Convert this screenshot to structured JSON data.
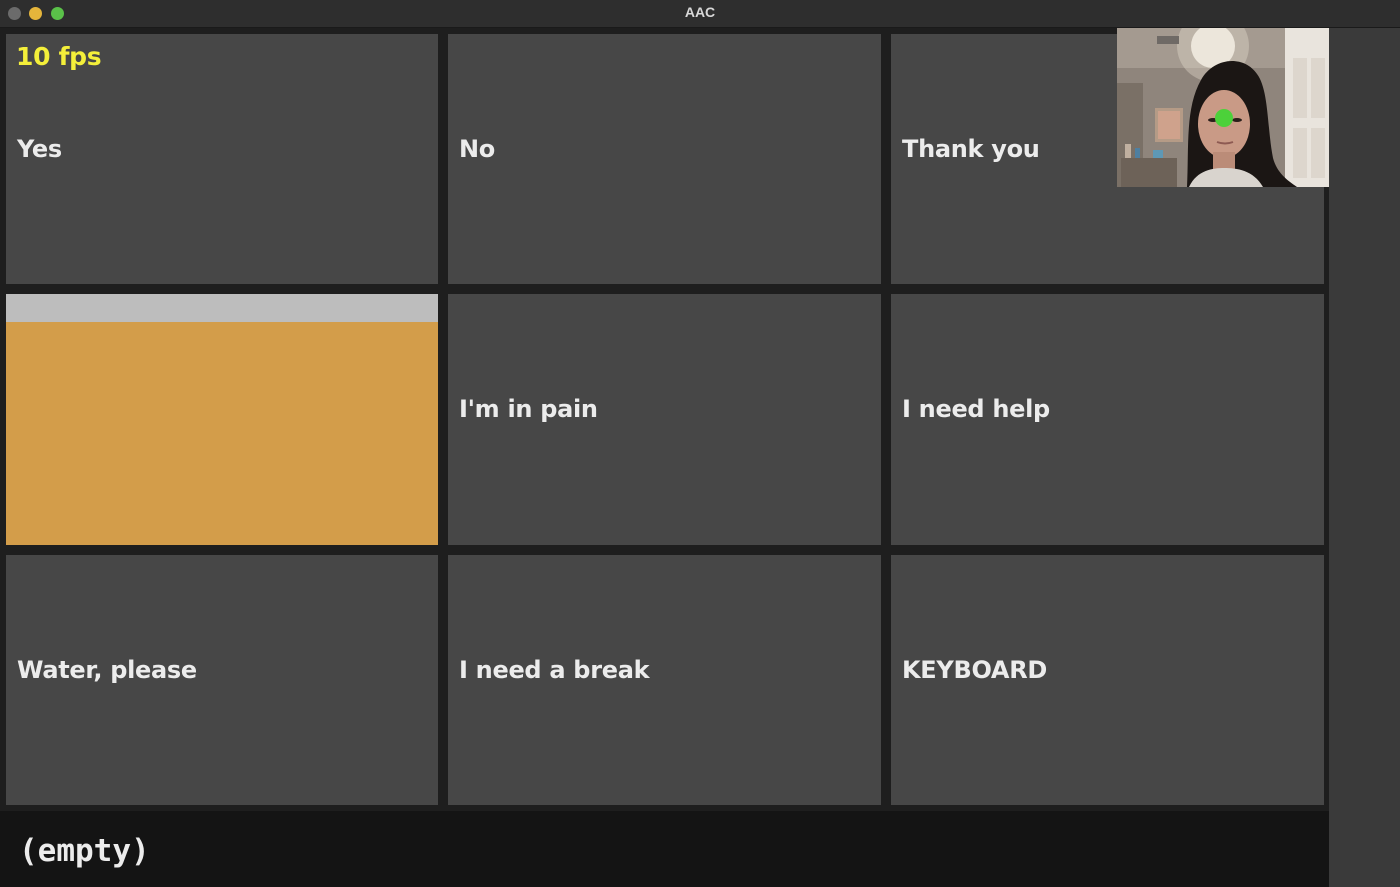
{
  "window": {
    "title": "AAC"
  },
  "status": {
    "fps": "10 fps"
  },
  "tiles": [
    {
      "label": "Yes"
    },
    {
      "label": "No"
    },
    {
      "label": "Thank you"
    },
    {
      "label": ""
    },
    {
      "label": "I'm in pain"
    },
    {
      "label": "I need help"
    },
    {
      "label": "Water, please"
    },
    {
      "label": "I need a break"
    },
    {
      "label": "KEYBOARD"
    }
  ],
  "output": {
    "text": "(empty)"
  },
  "colors": {
    "tile": "#474747",
    "active_tile": "#d39d4a",
    "dwell_progress": "#bdbdbd",
    "fps_text": "#f4ef3a",
    "gaze_dot": "#4cd13a"
  },
  "camera": {
    "gaze_indicator": "green-dot"
  }
}
